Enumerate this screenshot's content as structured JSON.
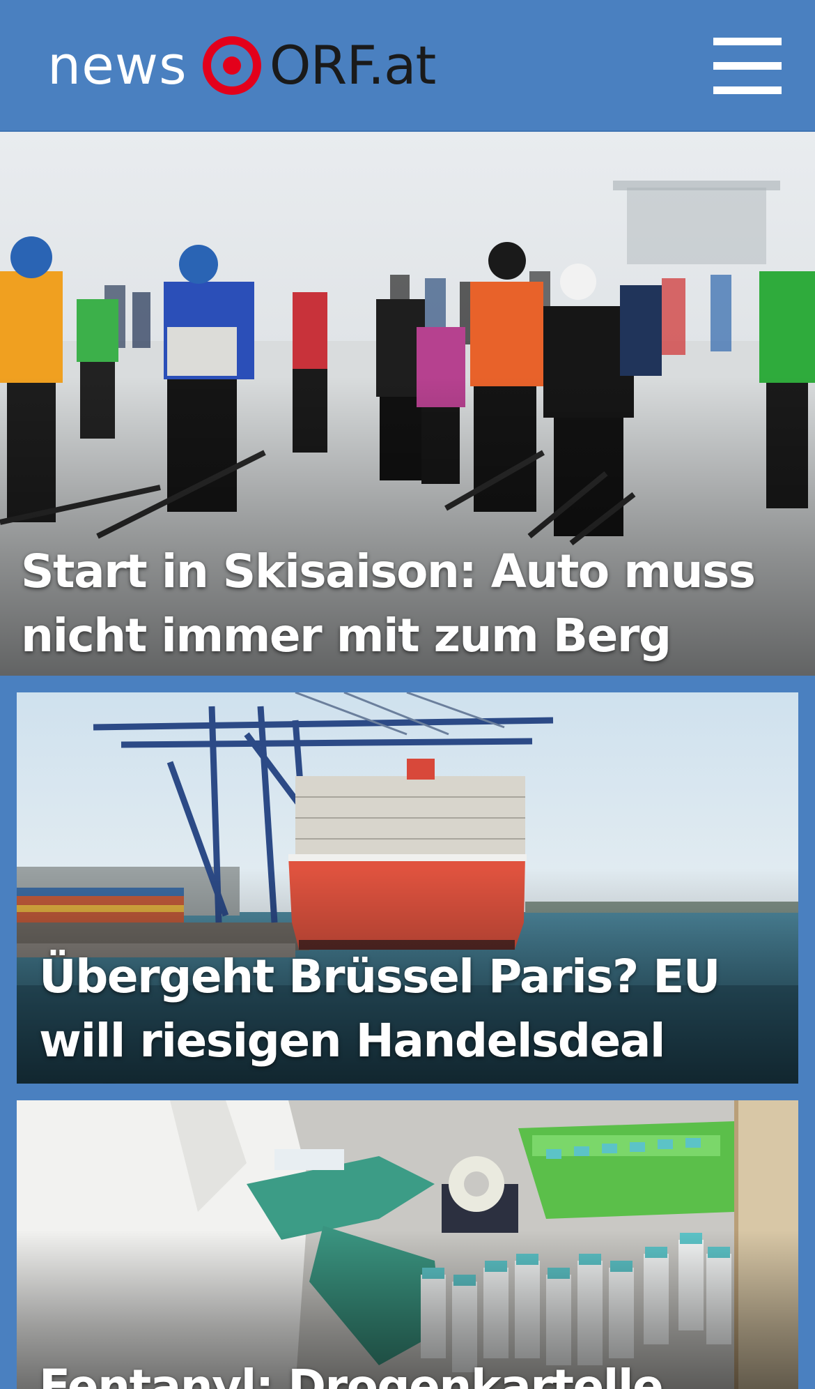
{
  "header": {
    "logo_prefix": "news",
    "logo_brand": "ORF.at",
    "menu_icon": "hamburger-menu-icon",
    "background_color": "#4a80c0",
    "logo_accent_color": "#e3001b"
  },
  "stories": [
    {
      "title": "Start in Skisaison: Auto muss nicht immer mit zum Berg"
    },
    {
      "title": "Übergeht Brüssel Paris? EU will riesigen Handelsdeal fixieren"
    },
    {
      "title": "Fentanyl: Drogenkartelle"
    }
  ]
}
